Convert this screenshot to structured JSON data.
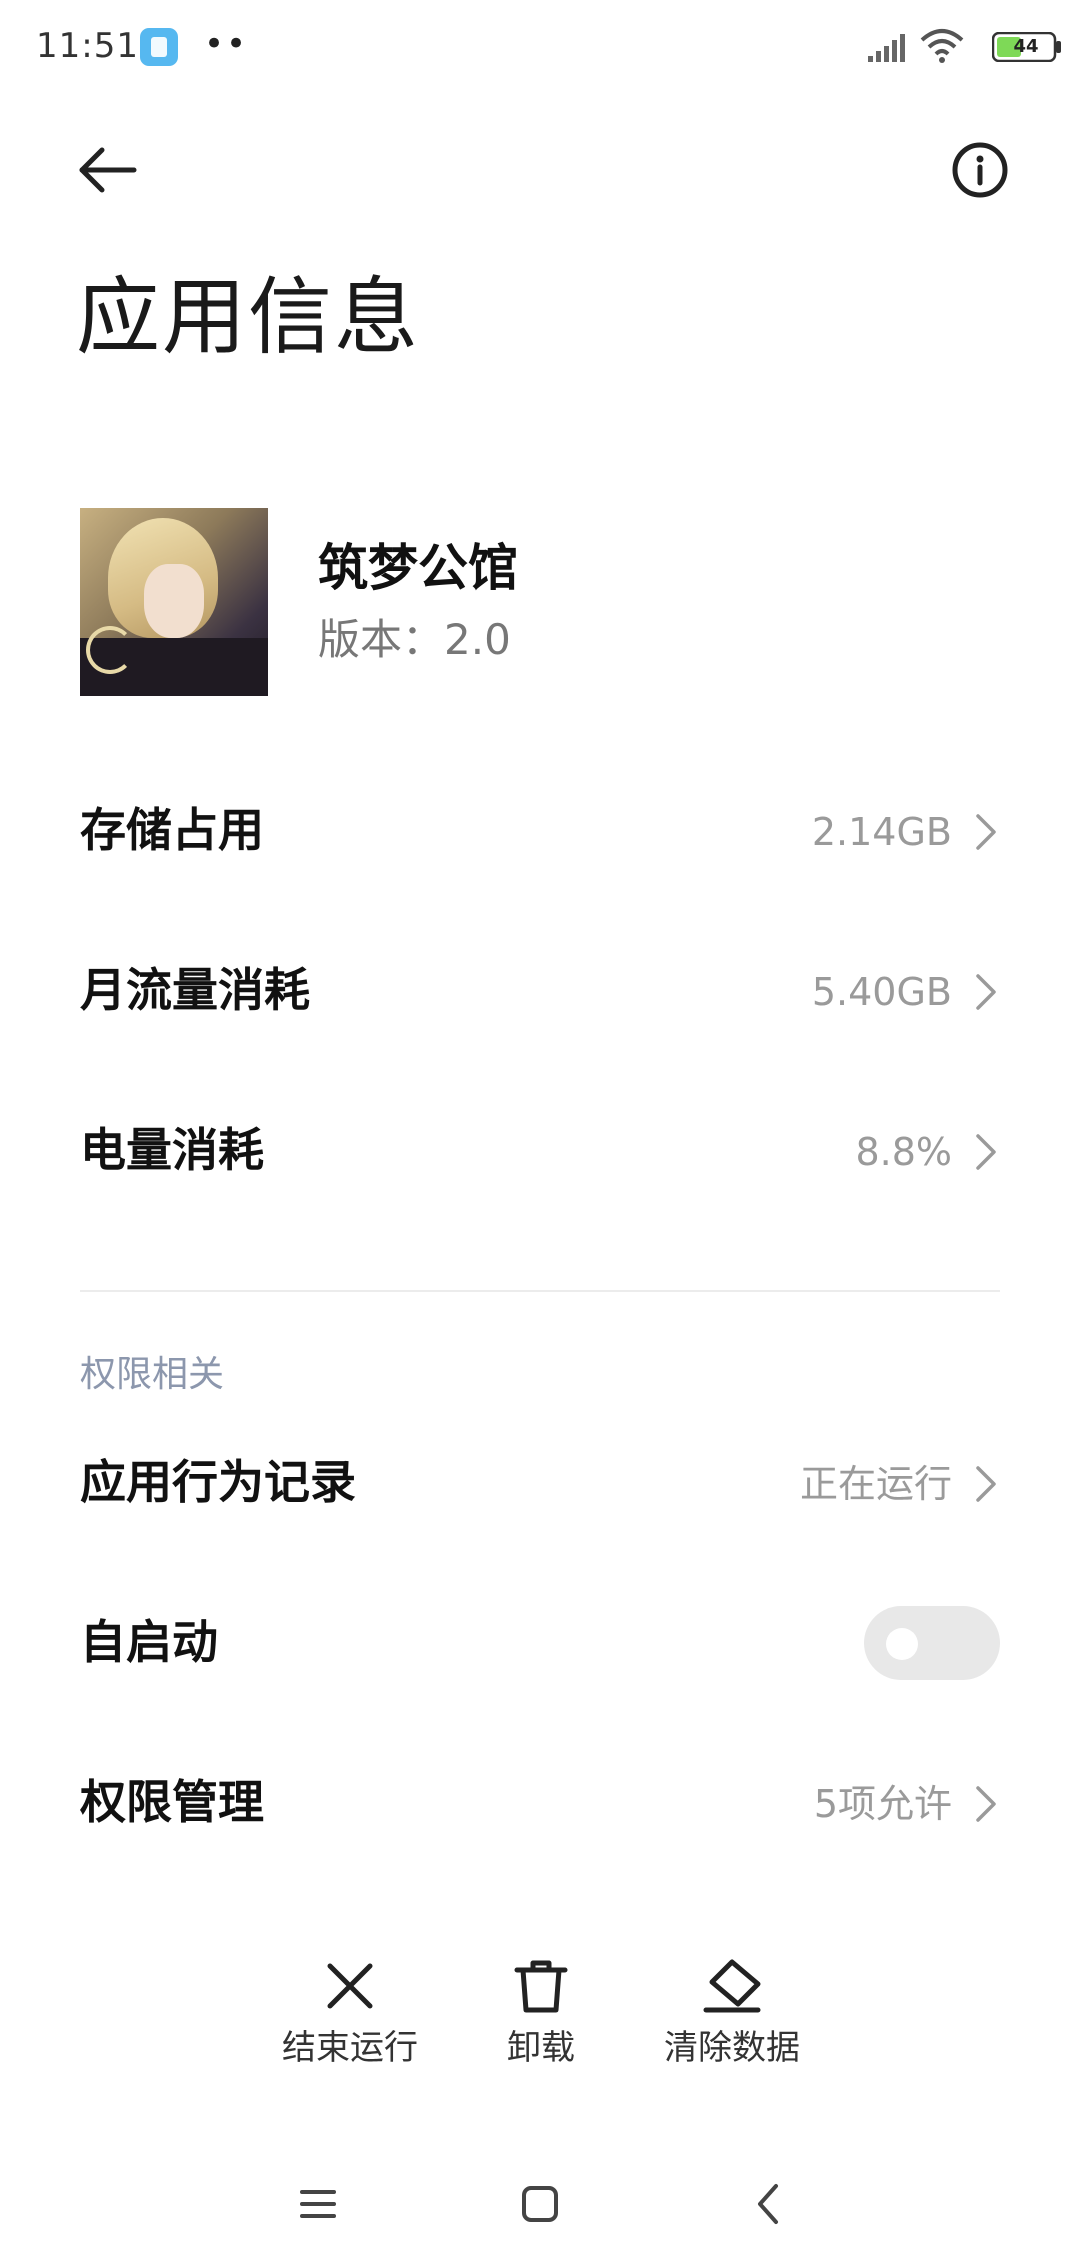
{
  "status_bar": {
    "time": "11:51",
    "dots": "••",
    "battery": "44",
    "icons": [
      "app-notification-icon",
      "signal-icon",
      "wifi-icon",
      "battery-icon"
    ]
  },
  "header": {
    "back_icon": "arrow-left-icon",
    "info_icon": "info-circle-icon",
    "title": "应用信息"
  },
  "app": {
    "name": "筑梦公馆",
    "version": "版本：2.0"
  },
  "rows": [
    {
      "label": "存储占用",
      "value": "2.14GB"
    },
    {
      "label": "月流量消耗",
      "value": "5.40GB"
    },
    {
      "label": "电量消耗",
      "value": "8.8%"
    }
  ],
  "permissions": {
    "section_title": "权限相关",
    "behavior_record": {
      "label": "应用行为记录",
      "value": "正在运行"
    },
    "autostart": {
      "label": "自启动",
      "enabled": false
    },
    "manage": {
      "label": "权限管理",
      "value": "5项允许"
    }
  },
  "actions": [
    {
      "label": "结束运行",
      "icon": "close-x-icon"
    },
    {
      "label": "卸载",
      "icon": "trash-icon"
    },
    {
      "label": "清除数据",
      "icon": "eraser-icon"
    }
  ],
  "nav": {
    "icons": [
      "menu-icon",
      "home-square-icon",
      "back-chevron-icon"
    ]
  },
  "colors": {
    "section_header": "#8c97ad",
    "value_gray": "#9a9a9a",
    "status_app_icon": "#56b8f0",
    "battery_fill": "#7ed957"
  }
}
